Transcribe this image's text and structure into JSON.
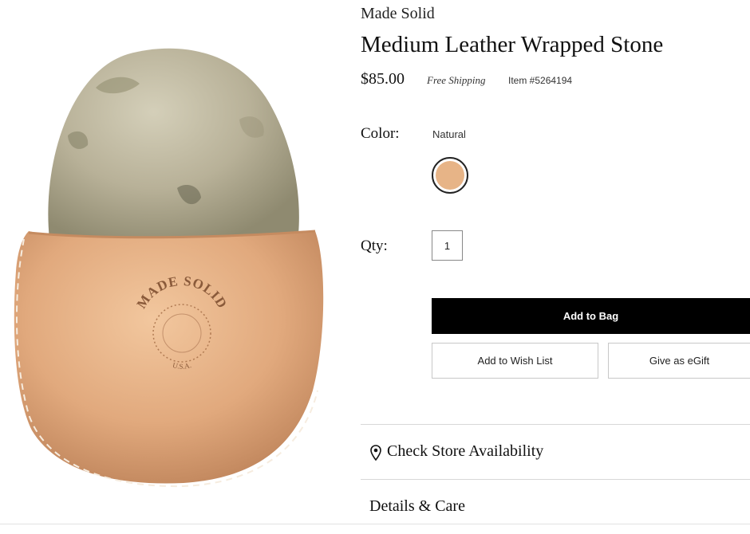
{
  "product": {
    "brand": "Made Solid",
    "title": "Medium Leather Wrapped Stone",
    "price": "$85.00",
    "shipping": "Free Shipping",
    "item_number": "Item #5264194",
    "image_stamp_top": "MADE SOLID",
    "image_stamp_bottom": "U.S.A."
  },
  "options": {
    "color_label": "Color:",
    "color_value": "Natural",
    "swatch_color": "#e7b487",
    "qty_label": "Qty:",
    "qty_value": "1"
  },
  "actions": {
    "add_to_bag": "Add to Bag",
    "add_to_wishlist": "Add to Wish List",
    "give_egift": "Give as eGift"
  },
  "sections": {
    "store_availability": "Check Store Availability",
    "details_care": "Details & Care"
  },
  "colors": {
    "button_bg": "#000000",
    "leather": "#dfa77c",
    "stone": "#b3ab8f"
  }
}
